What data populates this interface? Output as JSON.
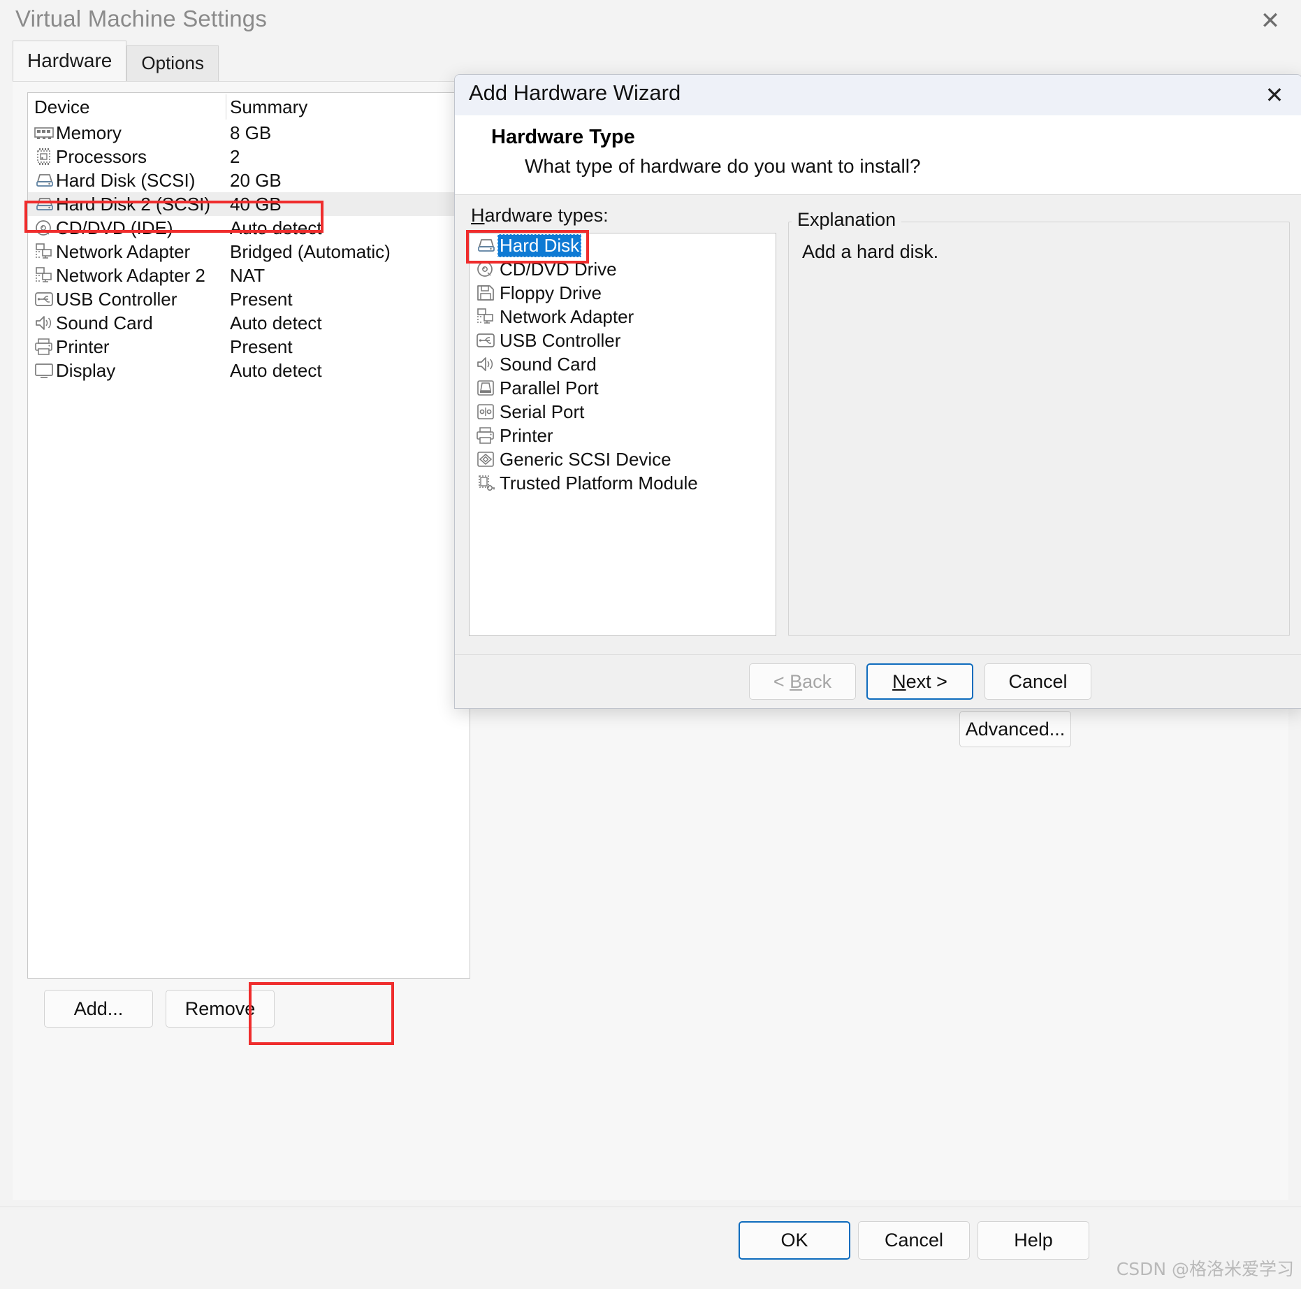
{
  "window": {
    "title": "Virtual Machine Settings",
    "close_icon": "close-icon"
  },
  "tabs": [
    {
      "label": "Hardware",
      "active": true
    },
    {
      "label": "Options",
      "active": false
    }
  ],
  "device_table": {
    "columns": [
      "Device",
      "Summary"
    ],
    "rows": [
      {
        "icon": "memory-icon",
        "device": "Memory",
        "summary": "8 GB",
        "selected": false
      },
      {
        "icon": "processor-icon",
        "device": "Processors",
        "summary": "2",
        "selected": false
      },
      {
        "icon": "harddisk-icon",
        "device": "Hard Disk (SCSI)",
        "summary": "20 GB",
        "selected": false
      },
      {
        "icon": "harddisk-icon",
        "device": "Hard Disk 2 (SCSI)",
        "summary": "40 GB",
        "selected": true
      },
      {
        "icon": "cddvd-icon",
        "device": "CD/DVD (IDE)",
        "summary": "Auto detect",
        "selected": false
      },
      {
        "icon": "network-adapter-icon",
        "device": "Network Adapter",
        "summary": "Bridged (Automatic)",
        "selected": false
      },
      {
        "icon": "network-adapter-icon",
        "device": "Network Adapter 2",
        "summary": "NAT",
        "selected": false
      },
      {
        "icon": "usb-controller-icon",
        "device": "USB Controller",
        "summary": "Present",
        "selected": false
      },
      {
        "icon": "sound-card-icon",
        "device": "Sound Card",
        "summary": "Auto detect",
        "selected": false
      },
      {
        "icon": "printer-icon",
        "device": "Printer",
        "summary": "Present",
        "selected": false
      },
      {
        "icon": "display-icon",
        "device": "Display",
        "summary": "Auto detect",
        "selected": false
      }
    ]
  },
  "list_buttons": {
    "add": "Add...",
    "remove": "Remove"
  },
  "right_pane": {
    "advanced": "Advanced..."
  },
  "dialog_buttons": {
    "ok": "OK",
    "cancel": "Cancel",
    "help": "Help"
  },
  "watermark": "CSDN @格洛米爱学习",
  "wizard": {
    "title": "Add Hardware Wizard",
    "close_icon": "close-icon",
    "heading": "Hardware Type",
    "subheading": "What type of hardware do you want to install?",
    "hardware_types_label_prefix": "H",
    "hardware_types_label_rest": "ardware types:",
    "hardware_types": [
      {
        "icon": "harddisk-icon",
        "label": "Hard Disk",
        "selected": true
      },
      {
        "icon": "cddvd-icon",
        "label": "CD/DVD Drive",
        "selected": false
      },
      {
        "icon": "floppy-icon",
        "label": "Floppy Drive",
        "selected": false
      },
      {
        "icon": "network-adapter-icon",
        "label": "Network Adapter",
        "selected": false
      },
      {
        "icon": "usb-controller-icon",
        "label": "USB Controller",
        "selected": false
      },
      {
        "icon": "sound-card-icon",
        "label": "Sound Card",
        "selected": false
      },
      {
        "icon": "parallel-port-icon",
        "label": "Parallel Port",
        "selected": false
      },
      {
        "icon": "serial-port-icon",
        "label": "Serial Port",
        "selected": false
      },
      {
        "icon": "printer-icon",
        "label": "Printer",
        "selected": false
      },
      {
        "icon": "generic-scsi-icon",
        "label": "Generic SCSI Device",
        "selected": false
      },
      {
        "icon": "tpm-icon",
        "label": "Trusted Platform Module",
        "selected": false
      }
    ],
    "explanation_legend": "Explanation",
    "explanation_text": "Add a hard disk.",
    "buttons": {
      "back_prefix": "< ",
      "back_accel": "B",
      "back_rest": "ack",
      "next_accel": "N",
      "next_rest": "ext >",
      "cancel": "Cancel"
    }
  }
}
